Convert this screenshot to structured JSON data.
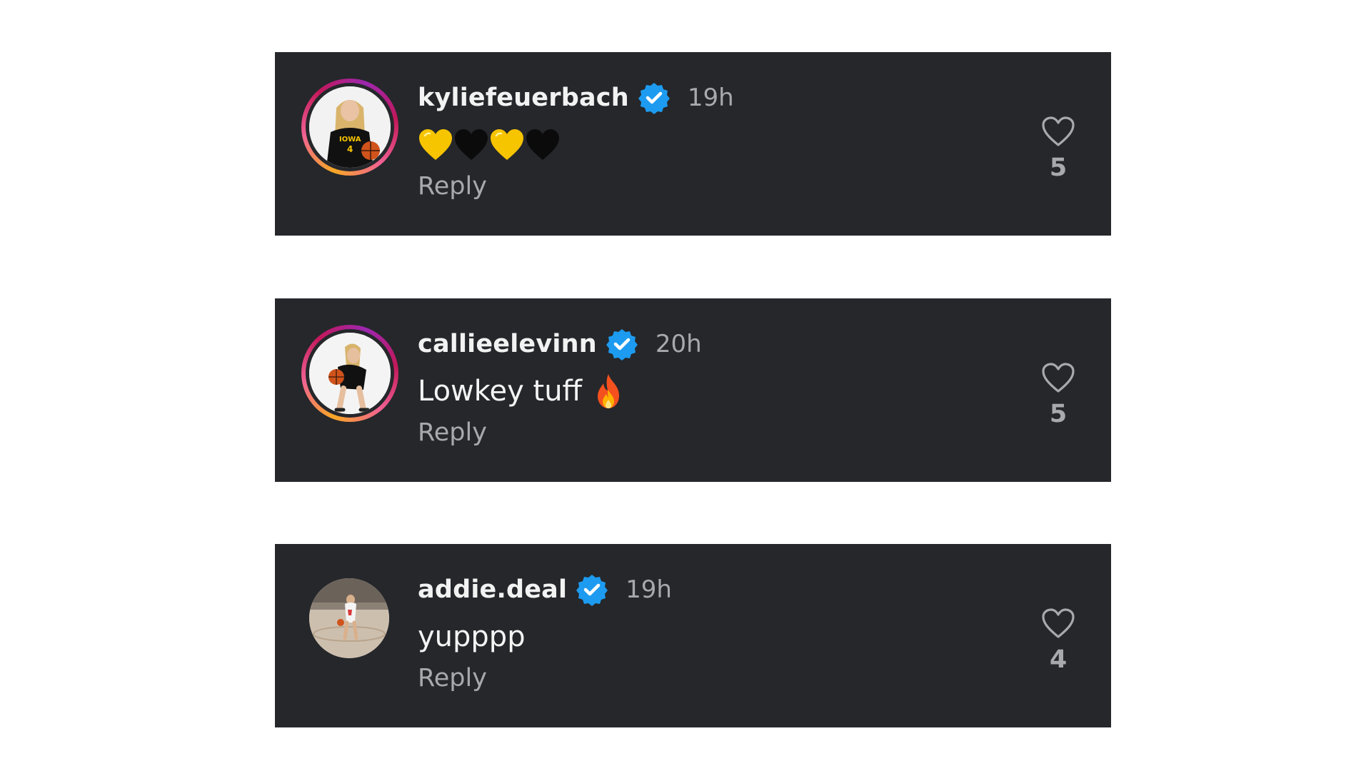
{
  "comments": [
    {
      "username": "kyliefeuerbach",
      "verified": true,
      "time": "19h",
      "text": "",
      "emojis": [
        "yellow-heart",
        "black-heart",
        "yellow-heart",
        "black-heart"
      ],
      "reply_label": "Reply",
      "likes": "5",
      "story_ring": true,
      "avatar_jersey": "IOWA 4"
    },
    {
      "username": "callieelevinn",
      "verified": true,
      "time": "20h",
      "text": "Lowkey tuff",
      "emojis": [
        "fire"
      ],
      "reply_label": "Reply",
      "likes": "5",
      "story_ring": true
    },
    {
      "username": "addie.deal",
      "verified": true,
      "time": "19h",
      "text": "yupppp",
      "emojis": [],
      "reply_label": "Reply",
      "likes": "4",
      "story_ring": false
    }
  ],
  "colors": {
    "card_bg": "#25272b",
    "page_bg": "#ffffff",
    "username": "#f2f2f2",
    "secondary": "#a7a9ad",
    "verified_blue": "#1d9bf0",
    "yellow_heart": "#f7c400"
  },
  "icons": {
    "verified": "verified-badge-icon",
    "like": "heart-outline-icon"
  }
}
